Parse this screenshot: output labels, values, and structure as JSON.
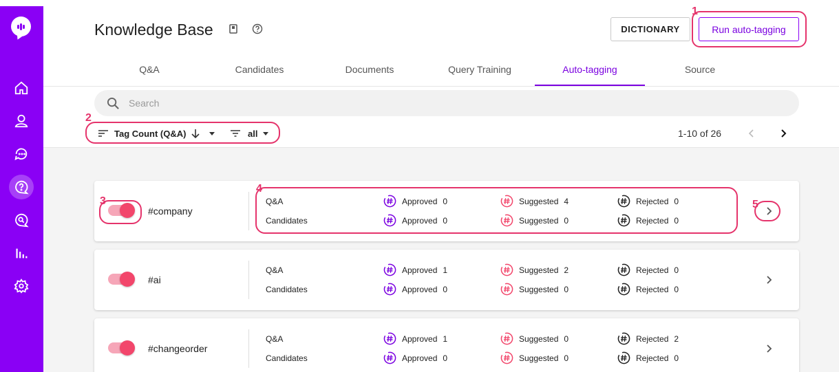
{
  "sidebar": {
    "items": [
      {
        "icon": "home-icon"
      },
      {
        "icon": "user-icon"
      },
      {
        "icon": "chat-icon"
      },
      {
        "icon": "knowledge-base-icon",
        "active": true
      },
      {
        "icon": "search-chat-icon"
      },
      {
        "icon": "analytics-icon"
      },
      {
        "icon": "settings-icon"
      }
    ]
  },
  "header": {
    "title": "Knowledge Base",
    "dictionary_label": "DICTIONARY",
    "run_label": "Run auto-tagging"
  },
  "tabs": [
    {
      "label": "Q&A"
    },
    {
      "label": "Candidates"
    },
    {
      "label": "Documents"
    },
    {
      "label": "Query Training"
    },
    {
      "label": "Auto-tagging",
      "active": true
    },
    {
      "label": "Source"
    }
  ],
  "search": {
    "placeholder": "Search"
  },
  "filters": {
    "sort_label": "Tag Count (Q&A)",
    "filter_label": "all"
  },
  "pager": {
    "text": "1-10 of 26"
  },
  "labels": {
    "qa": "Q&A",
    "candidates": "Candidates",
    "approved": "Approved",
    "suggested": "Suggested",
    "rejected": "Rejected"
  },
  "cards": [
    {
      "tag": "#company",
      "qa": {
        "approved": "0",
        "suggested": "4",
        "rejected": "0"
      },
      "candidates": {
        "approved": "0",
        "suggested": "0",
        "rejected": "0"
      }
    },
    {
      "tag": "#ai",
      "qa": {
        "approved": "1",
        "suggested": "2",
        "rejected": "0"
      },
      "candidates": {
        "approved": "0",
        "suggested": "0",
        "rejected": "0"
      }
    },
    {
      "tag": "#changeorder",
      "qa": {
        "approved": "1",
        "suggested": "0",
        "rejected": "2"
      },
      "candidates": {
        "approved": "0",
        "suggested": "0",
        "rejected": "0"
      }
    }
  ],
  "annotations": [
    "1",
    "2",
    "3",
    "4",
    "5"
  ],
  "colors": {
    "sidebar": "#8a00f5",
    "accent": "#7a00e0",
    "toggle": "#f2466b",
    "annotation": "#e5336b",
    "approved_icon": "#7a00e0",
    "suggested_icon": "#f2466b",
    "rejected_icon": "#212121"
  }
}
